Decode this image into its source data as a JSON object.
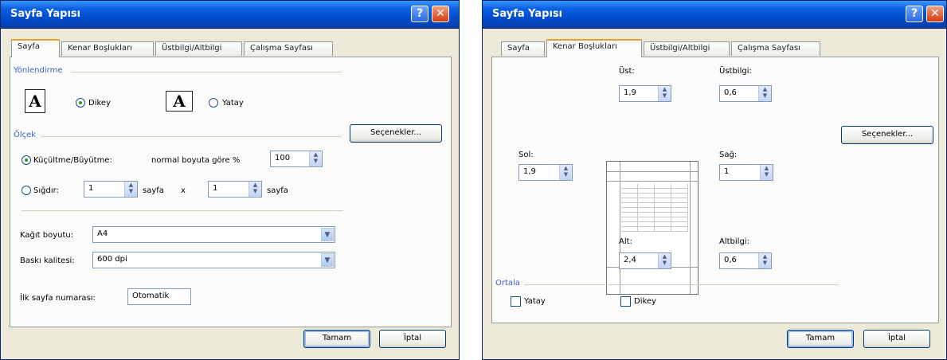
{
  "dialog1": {
    "title": "Sayfa Yapısı",
    "help_label": "?",
    "close_label": "✕",
    "tabs": [
      "Sayfa",
      "Kenar Boşlukları",
      "Üstbilgi/Altbilgi",
      "Çalışma Sayfası"
    ],
    "orientation": {
      "group_label": "Yönlendirme",
      "portrait_icon": "A",
      "portrait_label": "Dikey",
      "landscape_icon": "A",
      "landscape_label": "Yatay",
      "selected": "portrait"
    },
    "scale": {
      "group_label": "Ölçek",
      "adjust_label": "Küçültme/Büyütme:",
      "adjust_text": "normal boyuta göre %",
      "adjust_value": "100",
      "fit_label": "Sığdır:",
      "fit_wide_value": "1",
      "fit_wide_unit": "sayfa",
      "times": "x",
      "fit_tall_value": "1",
      "fit_tall_unit": "sayfa"
    },
    "paper_size_label": "Kağıt boyutu:",
    "paper_size_value": "A4",
    "print_quality_label": "Baskı kalitesi:",
    "print_quality_value": "600 dpi",
    "first_page_label": "İlk sayfa numarası:",
    "first_page_value": "Otomatik",
    "options_button": "Seçenekler...",
    "ok_button": "Tamam",
    "cancel_button": "İptal"
  },
  "dialog2": {
    "title": "Sayfa Yapısı",
    "help_label": "?",
    "close_label": "✕",
    "tabs": [
      "Sayfa",
      "Kenar Boşlukları",
      "Üstbilgi/Altbilgi",
      "Çalışma Sayfası"
    ],
    "top_label": "Üst:",
    "top_value": "1,9",
    "header_label": "Üstbilgi:",
    "header_value": "0,6",
    "left_label": "Sol:",
    "left_value": "1,9",
    "right_label": "Sağ:",
    "right_value": "1",
    "bottom_label": "Alt:",
    "bottom_value": "2,4",
    "footer_label": "Altbilgi:",
    "footer_value": "0,6",
    "center_group_label": "Ortala",
    "center_horizontal_label": "Yatay",
    "center_vertical_label": "Dikey",
    "options_button": "Seçenekler...",
    "ok_button": "Tamam",
    "cancel_button": "İptal"
  },
  "spin_up": "▲",
  "spin_down": "▼",
  "dropdown_arrow": "▼"
}
